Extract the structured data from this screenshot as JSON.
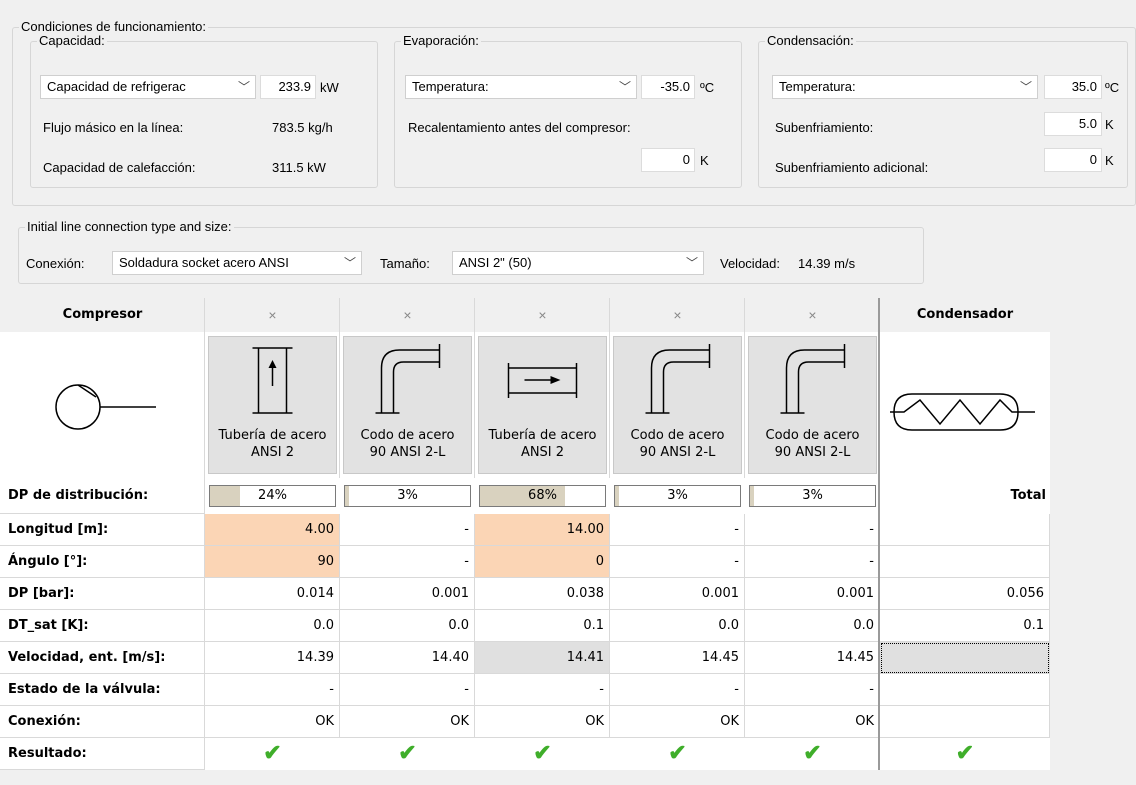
{
  "conditions": {
    "legend": "Condiciones de funcionamiento:",
    "capacity": {
      "legend": "Capacidad:",
      "type_select": "Capacidad de refrigerac",
      "value": "233.9",
      "unit": "kW",
      "mass_flow_label": "Flujo másico en la línea:",
      "mass_flow_value": "783.5 kg/h",
      "heating_label": "Capacidad de calefacción:",
      "heating_value": "311.5 kW"
    },
    "evaporation": {
      "legend": "Evaporación:",
      "select": "Temperatura:",
      "value": "-35.0",
      "unit": "ºC",
      "superheat_label": "Recalentamiento antes del compresor:",
      "superheat_value": "0",
      "superheat_unit": "K"
    },
    "condensation": {
      "legend": "Condensación:",
      "select": "Temperatura:",
      "value": "35.0",
      "unit": "ºC",
      "subcool_label": "Subenfriamiento:",
      "subcool_value": "5.0",
      "subcool_unit": "K",
      "add_subcool_label": "Subenfriamiento adicional:",
      "add_subcool_value": "0",
      "add_subcool_unit": "K"
    }
  },
  "connection": {
    "legend": "Initial line connection type and size:",
    "conn_label": "Conexión:",
    "conn_select": "Soldadura socket acero ANSI",
    "size_label": "Tamaño:",
    "size_select": "ANSI 2\" (50)",
    "velocity_label": "Velocidad:",
    "velocity_value": "14.39 m/s"
  },
  "grid": {
    "compressor_header": "Compresor",
    "condenser_header": "Condensador",
    "close_glyph": "×",
    "total_label": "Total",
    "row_labels": {
      "dp_dist": "DP de distribución:",
      "length": "Longitud [m]:",
      "angle": "Ángulo [°]:",
      "dp": "DP [bar]:",
      "dt_sat": "DT_sat [K]:",
      "velocity": "Velocidad, ent. [m/s]:",
      "valve": "Estado de la válvula:",
      "connection": "Conexión:",
      "result": "Resultado:"
    },
    "components": [
      {
        "icon": "pipe",
        "label1": "Tubería de acero",
        "label2": "ANSI 2",
        "dp_dist": "24%",
        "dp_dist_fraction": 0.24,
        "length": "4.00",
        "angle": "90",
        "dp": "0.014",
        "dt_sat": "0.0",
        "velocity": "14.39",
        "valve": "-",
        "connection": "OK"
      },
      {
        "icon": "elbow",
        "label1": "Codo de acero",
        "label2": "90 ANSI 2-L",
        "dp_dist": "3%",
        "dp_dist_fraction": 0.03,
        "length": "-",
        "angle": "-",
        "dp": "0.001",
        "dt_sat": "0.0",
        "velocity": "14.40",
        "valve": "-",
        "connection": "OK"
      },
      {
        "icon": "pipe-horizontal",
        "label1": "Tubería de acero",
        "label2": "ANSI 2",
        "dp_dist": "68%",
        "dp_dist_fraction": 0.68,
        "length": "14.00",
        "angle": "0",
        "dp": "0.038",
        "dt_sat": "0.1",
        "velocity": "14.41",
        "valve": "-",
        "connection": "OK"
      },
      {
        "icon": "elbow",
        "label1": "Codo de acero",
        "label2": "90 ANSI 2-L",
        "dp_dist": "3%",
        "dp_dist_fraction": 0.03,
        "length": "-",
        "angle": "-",
        "dp": "0.001",
        "dt_sat": "0.0",
        "velocity": "14.45",
        "valve": "-",
        "connection": "OK"
      },
      {
        "icon": "elbow",
        "label1": "Codo de acero",
        "label2": "90 ANSI 2-L",
        "dp_dist": "3%",
        "dp_dist_fraction": 0.03,
        "length": "-",
        "angle": "-",
        "dp": "0.001",
        "dt_sat": "0.0",
        "velocity": "14.45",
        "valve": "-",
        "connection": "OK"
      }
    ],
    "totals": {
      "dp": "0.056",
      "dt_sat": "0.1"
    },
    "colors": {
      "highlight": "#fbd5b5",
      "selected": "#e0e0e0",
      "check": "#3fae2a"
    }
  }
}
